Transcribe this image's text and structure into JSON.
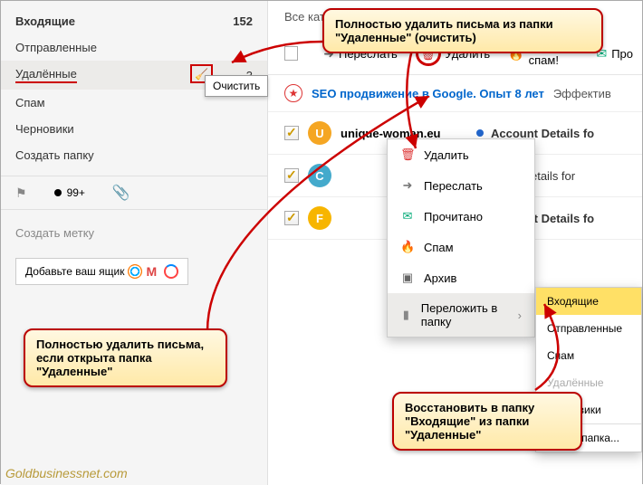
{
  "sidebar": {
    "inbox": {
      "label": "Входящие",
      "count": "152"
    },
    "sent": {
      "label": "Отправленные"
    },
    "deleted": {
      "label": "Удалённые",
      "count": "3"
    },
    "spam": {
      "label": "Спам"
    },
    "drafts": {
      "label": "Черновики"
    },
    "create_folder": {
      "label": "Создать папку"
    },
    "unread_count": "99+",
    "create_label": "Создать метку",
    "addbox": "Добавьте ваш ящик",
    "tooltip": "Очистить"
  },
  "tabs": {
    "all": "Все кат"
  },
  "toolbar": {
    "forward": "Переслать",
    "delete": "Удалить",
    "spam": "Это спам!",
    "read": "Про"
  },
  "promo": {
    "link": "SEO продвижение в Google. Опыт 8 лет",
    "tail": "Эффектив"
  },
  "rows": [
    {
      "sender": "unique-woman.eu",
      "subject": "Account Details fo",
      "unread": true,
      "avatar": "U"
    },
    {
      "sender": "",
      "subject": "Account Details for",
      "unread": false,
      "avatar": "C"
    },
    {
      "sender": "",
      "subject": "Account Details fo",
      "unread": true,
      "avatar": "F"
    }
  ],
  "ctx": {
    "delete": "Удалить",
    "forward": "Переслать",
    "read": "Прочитано",
    "spam": "Спам",
    "archive": "Архив",
    "move": "Переложить в папку"
  },
  "sub": {
    "inbox": "Входящие",
    "sent": "Отправленные",
    "spam": "Спам",
    "deleted": "Удалённые",
    "drafts": "Черновики",
    "new": "Новая папка..."
  },
  "callouts": {
    "c1": "Полностью удалить письма из папки \"Удаленные\" (очистить)",
    "c2": "Полностью удалить письма, если открыта папка \"Удаленные\"",
    "c3": "Восстановить в папку \"Входящие\" из папки \"Удаленные\""
  },
  "watermark": "Goldbusinessnet.com"
}
